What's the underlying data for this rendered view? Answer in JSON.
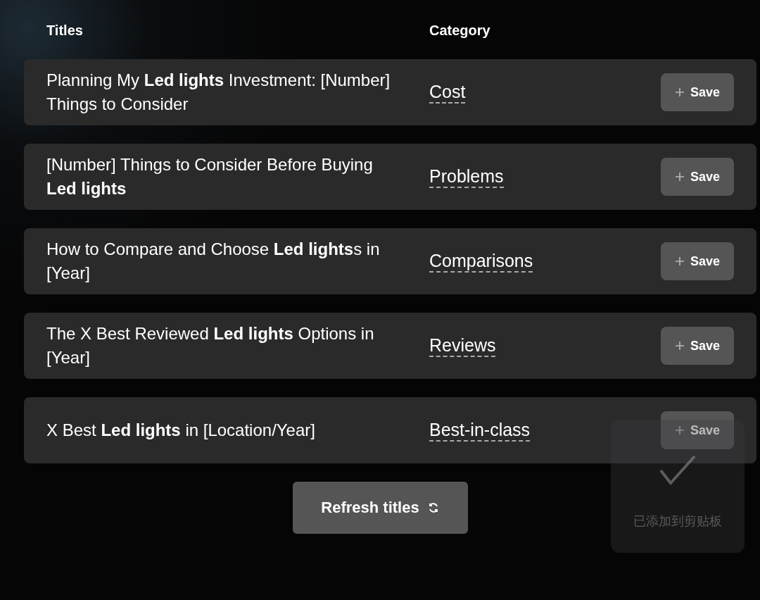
{
  "columns": [
    "Titles",
    "Category"
  ],
  "rows": [
    {
      "title": "Planning My **Led lights** Investment: [Number] Things to Consider",
      "category": "Cost",
      "button": "Save"
    },
    {
      "title": "[Number] Things to Consider Before Buying **Led lights**",
      "category": "Problems",
      "button": "Save"
    },
    {
      "title": "How to Compare and Choose **Led lights**s in [Year]",
      "category": "Comparisons",
      "button": "Save"
    },
    {
      "title": "The X Best Reviewed **Led lights** Options in [Year]",
      "category": "Reviews",
      "button": "Save"
    },
    {
      "title": "X Best **Led lights** in [Location/Year]",
      "category": "Best-in-class",
      "button": "Save"
    }
  ],
  "refresh_button": "Refresh titles",
  "toast": {
    "message": "已添加到剪贴板"
  }
}
